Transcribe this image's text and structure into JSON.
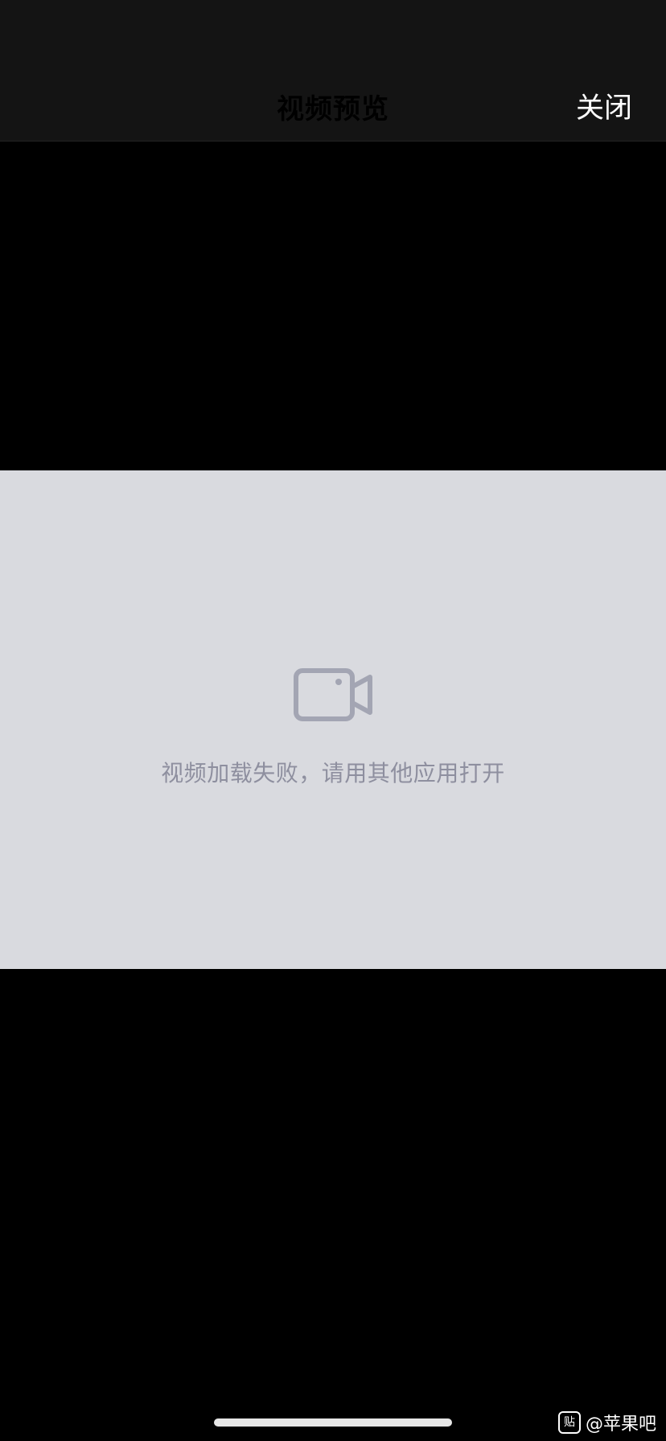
{
  "nav": {
    "title": "视频预览",
    "close_label": "关闭"
  },
  "player": {
    "icon": "video-camera-icon",
    "error_message": "视频加载失败，请用其他应用打开"
  },
  "watermark": {
    "logo_text": "贴",
    "handle": "@苹果吧"
  },
  "colors": {
    "nav_background": "#141414",
    "error_panel": "#d9dadf",
    "error_text": "#8e8f9f",
    "icon": "#a3a5b3"
  }
}
